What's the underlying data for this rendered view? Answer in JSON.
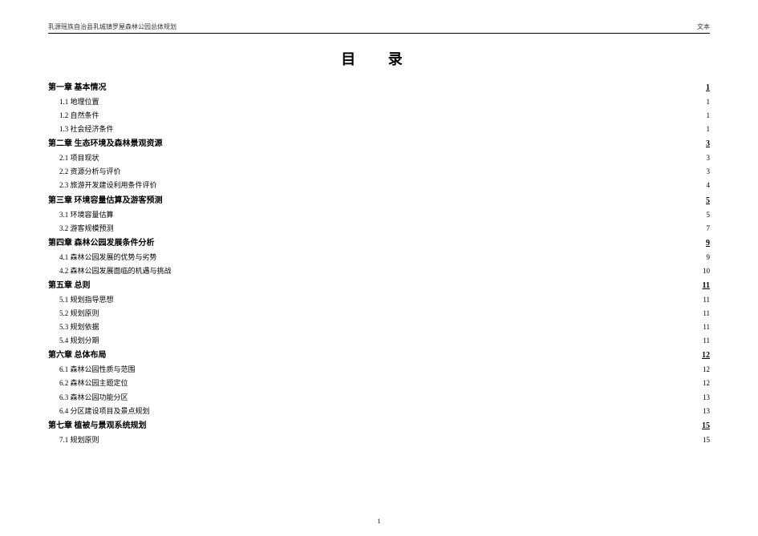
{
  "header": {
    "left": "乳源瑶族自治县乳城镇罗屋森林公园总体规划",
    "right": "文本"
  },
  "title": "目  录",
  "footer": {
    "page_number": "1"
  },
  "toc": [
    {
      "type": "chapter",
      "label": "第一章  基本情况",
      "page": "1"
    },
    {
      "type": "section",
      "label": "1.1  地理位置",
      "page": "1"
    },
    {
      "type": "section",
      "label": "1.2  自然条件",
      "page": "1"
    },
    {
      "type": "section",
      "label": "1.3  社会经济条件",
      "page": "1"
    },
    {
      "type": "chapter",
      "label": "第二章  生态环境及森林景观资源",
      "page": "3"
    },
    {
      "type": "section",
      "label": "2.1  项目现状",
      "page": "3"
    },
    {
      "type": "section",
      "label": "2.2  资源分析与评价",
      "page": "3"
    },
    {
      "type": "section",
      "label": "2.3  旅游开发建设利用条件评价",
      "page": "4"
    },
    {
      "type": "chapter",
      "label": "第三章  环境容量估算及游客预测",
      "page": "5"
    },
    {
      "type": "section",
      "label": "3.1  环境容量估算",
      "page": "5"
    },
    {
      "type": "section",
      "label": "3.2  游客规模预测",
      "page": "7"
    },
    {
      "type": "chapter",
      "label": "第四章  森林公园发展条件分析",
      "page": "9"
    },
    {
      "type": "section",
      "label": "4.1  森林公园发展的优势与劣势",
      "page": "9"
    },
    {
      "type": "section",
      "label": "4.2  森林公园发展面临的机遇与挑战",
      "page": "10"
    },
    {
      "type": "chapter",
      "label": "第五章  总则",
      "page": "11"
    },
    {
      "type": "section",
      "label": "5.1  规划指导思想",
      "page": "11"
    },
    {
      "type": "section",
      "label": "5.2  规划原则",
      "page": "11"
    },
    {
      "type": "section",
      "label": "5.3  规划依据",
      "page": "11"
    },
    {
      "type": "section",
      "label": "5.4  规划分期",
      "page": "11"
    },
    {
      "type": "chapter",
      "label": "第六章  总体布局",
      "page": "12"
    },
    {
      "type": "section",
      "label": "6.1  森林公园性质与范围",
      "page": "12"
    },
    {
      "type": "section",
      "label": "6.2  森林公园主题定位",
      "page": "12"
    },
    {
      "type": "section",
      "label": "6.3  森林公园功能分区",
      "page": "13"
    },
    {
      "type": "section",
      "label": "6.4  分区建设项目及景点规划",
      "page": "13"
    },
    {
      "type": "chapter",
      "label": "第七章  植被与景观系统规划",
      "page": "15"
    },
    {
      "type": "section",
      "label": "7.1  规划原则",
      "page": "15"
    }
  ]
}
